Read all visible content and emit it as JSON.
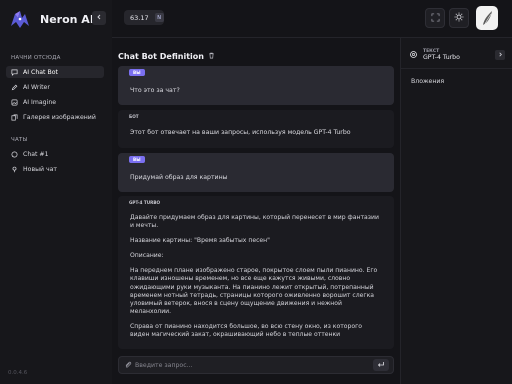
{
  "app": {
    "title": "Neron AI",
    "version": "0.0.4.6"
  },
  "colors": {
    "accent": "#7a6ff0",
    "background": "#141418",
    "sidebar": "#17171b",
    "user_bubble": "#2a2a32"
  },
  "topbar": {
    "tokens": "63.17",
    "token_badge": "N"
  },
  "sidebar": {
    "start_label": "НАЧНИ ОТСЮДА",
    "items": [
      {
        "label": "AI Chat Bot",
        "icon": "chat-icon",
        "active": true
      },
      {
        "label": "AI Writer",
        "icon": "pen-icon",
        "active": false
      },
      {
        "label": "AI Imagine",
        "icon": "image-icon",
        "active": false
      },
      {
        "label": "Галерея изображений",
        "icon": "gallery-icon",
        "active": false
      }
    ],
    "chats_label": "ЧАТЫ",
    "chats": [
      {
        "label": "Chat #1",
        "icon": "chat-icon"
      },
      {
        "label": "Новый чат",
        "icon": "pin-icon"
      }
    ]
  },
  "chat": {
    "title": "Chat Bot Definition",
    "messages": [
      {
        "role": "user",
        "badge": "ВЫ",
        "text": "Что это за чат?"
      },
      {
        "role": "bot",
        "badge": "БОТ",
        "text": "Этот бот отвечает на ваши запросы, используя модель GPT-4 Turbo"
      },
      {
        "role": "user",
        "badge": "ВЫ",
        "text": "Придумай образ для картины"
      },
      {
        "role": "bot",
        "badge": "GPT-4 TURBO",
        "paragraphs": [
          "Давайте придумаем образ для картины, который перенесет в мир фантазии и мечты.",
          "Название картины: \"Время забытых песен\"",
          "Описание:",
          "На переднем плане изображено старое, покрытое слоем пыли пианино. Его клавиши изношены временем, но все еще кажутся живыми, словно ожидающими руки музыканта. На пианино лежит открытый, потрепанный временем нотный тетрадь, страницы которого оживленно ворошит слегка уловимый ветерок, внося в сцену ощущение движения и нежной меланхолии.",
          "Справа от пианино находится большое, во всю стену окно, из которого виден магический закат, окрашивающий небо в теплые оттенки оранжевого, розового и лавандового. Лучи заходящего солнца проникают в комнату, играя на клавишах и нотных страницах, создавая атмосферу умиротворения и в то же время ностальгии по"
        ]
      }
    ],
    "input_placeholder": "Введите запрос..."
  },
  "right_panel": {
    "model_label": "ТЕКСТ",
    "model_name": "GPT-4 Turbo",
    "attachments_label": "Вложения"
  }
}
